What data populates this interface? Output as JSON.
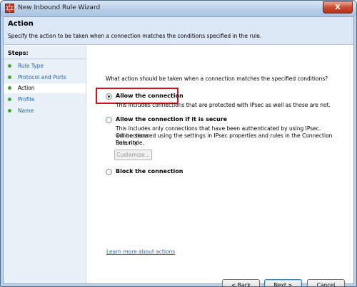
{
  "window": {
    "title": "New Inbound Rule Wizard",
    "close_label": "X"
  },
  "header": {
    "title": "Action",
    "subtitle": "Specify the action to be taken when a connection matches the conditions specified in the rule."
  },
  "steps": {
    "title": "Steps:",
    "items": [
      {
        "label": "Rule Type",
        "current": false
      },
      {
        "label": "Protocol and Ports",
        "current": false
      },
      {
        "label": "Action",
        "current": true
      },
      {
        "label": "Profile",
        "current": false
      },
      {
        "label": "Name",
        "current": false
      }
    ]
  },
  "main": {
    "question": "What action should be taken when a connection matches the specified conditions?",
    "options": [
      {
        "label": "Allow the connection",
        "description": "This includes connections that are protected with IPsec as well as those are not.",
        "selected": true
      },
      {
        "label": "Allow the connection if it is secure",
        "description_lines": [
          "This includes only connections that have been authenticated by using IPsec.  Connections",
          "will be secured using the settings in IPsec properties and rules in the Connection Security",
          "Rule node."
        ],
        "selected": false
      },
      {
        "label": "Block the connection",
        "selected": false
      }
    ],
    "customize_label": "Customize...",
    "learn_more": "Learn more about actions"
  },
  "footer": {
    "back_label": "< Back",
    "next_label": "Next >",
    "cancel_label": "Cancel"
  },
  "colors": {
    "highlight_border": "#d3141c",
    "link": "#1f66b4",
    "step_bullet": "#3ea62c"
  }
}
